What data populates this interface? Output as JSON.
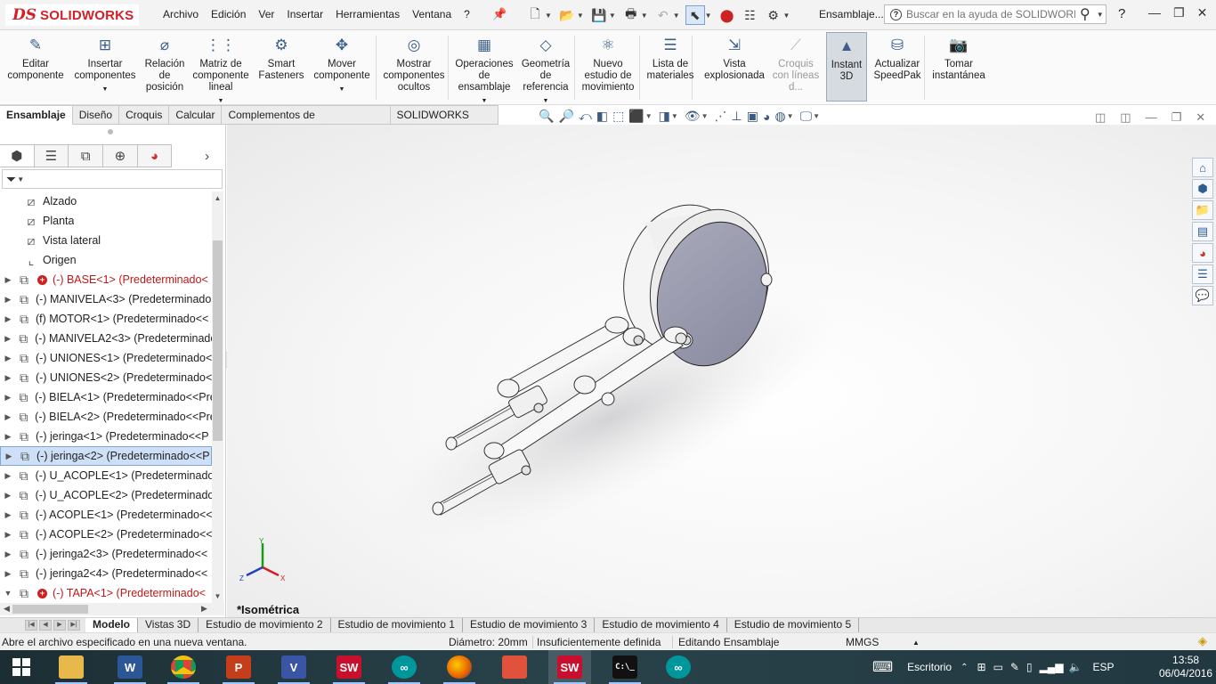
{
  "app": {
    "logo_ds": "DS",
    "logo_text": "SOLIDWORKS",
    "document_title": "Ensamblaje...",
    "search_placeholder": "Buscar en la ayuda de SOLIDWORKS",
    "help_label": "?"
  },
  "menu": [
    "Archivo",
    "Edición",
    "Ver",
    "Insertar",
    "Herramientas",
    "Ventana",
    "?"
  ],
  "ribbon": [
    {
      "label": "Editar componente",
      "icon": "edit-component-icon"
    },
    {
      "label": "Insertar componentes",
      "icon": "insert-components-icon",
      "dropdown": true
    },
    {
      "label": "Relación de posición",
      "icon": "mate-icon"
    },
    {
      "label": "Matriz de componente lineal",
      "icon": "linear-pattern-icon",
      "dropdown": true
    },
    {
      "label": "Smart Fasteners",
      "icon": "smart-fasteners-icon"
    },
    {
      "label": "Mover componente",
      "icon": "move-component-icon",
      "dropdown": true
    },
    {
      "label": "Mostrar componentes ocultos",
      "icon": "show-hidden-icon"
    },
    {
      "label": "Operaciones de ensamblaje",
      "icon": "assembly-features-icon",
      "dropdown": true
    },
    {
      "label": "Geometría de referencia",
      "icon": "reference-geometry-icon",
      "dropdown": true
    },
    {
      "label": "Nuevo estudio de movimiento",
      "icon": "motion-study-icon"
    },
    {
      "label": "Lista de materiales",
      "icon": "bom-icon"
    },
    {
      "label": "Vista explosionada",
      "icon": "exploded-view-icon"
    },
    {
      "label": "Croquis con líneas d...",
      "icon": "explode-line-sketch-icon",
      "disabled": true
    },
    {
      "label": "Instant 3D",
      "icon": "instant3d-icon",
      "active": true
    },
    {
      "label": "Actualizar SpeedPak",
      "icon": "speedpak-icon"
    },
    {
      "label": "Tomar instantánea",
      "icon": "snapshot-icon"
    }
  ],
  "command_tabs": [
    "Ensamblaje",
    "Diseño",
    "Croquis",
    "Calcular",
    "Complementos de SOLIDWORKS",
    "SOLIDWORKS MBD"
  ],
  "active_command_tab": "Ensamblaje",
  "tree": [
    {
      "label": "Alzado",
      "icon": "plane-icon",
      "top": true
    },
    {
      "label": "Planta",
      "icon": "plane-icon",
      "top": true
    },
    {
      "label": "Vista lateral",
      "icon": "plane-icon",
      "top": true
    },
    {
      "label": "Origen",
      "icon": "origin-icon",
      "top": true
    },
    {
      "label": "(-) BASE<1> (Predeterminado<",
      "icon": "part-icon",
      "warning": true,
      "red": true
    },
    {
      "label": "(-) MANIVELA<3> (Predeterminado",
      "icon": "part-icon"
    },
    {
      "label": "(f) MOTOR<1> (Predeterminado<<",
      "icon": "part-icon"
    },
    {
      "label": "(-) MANIVELA2<3> (Predeterminado",
      "icon": "part-icon"
    },
    {
      "label": "(-) UNIONES<1> (Predeterminado<",
      "icon": "part-icon"
    },
    {
      "label": "(-) UNIONES<2> (Predeterminado<",
      "icon": "part-icon"
    },
    {
      "label": "(-) BIELA<1> (Predeterminado<<Pre",
      "icon": "part-icon"
    },
    {
      "label": "(-) BIELA<2> (Predeterminado<<Pre",
      "icon": "part-icon"
    },
    {
      "label": "(-) jeringa<1> (Predeterminado<<P",
      "icon": "part-icon"
    },
    {
      "label": "(-) jeringa<2> (Predeterminado<<P",
      "icon": "part-icon",
      "selected": true
    },
    {
      "label": "(-) U_ACOPLE<1> (Predeterminado",
      "icon": "part-icon"
    },
    {
      "label": "(-) U_ACOPLE<2> (Predeterminado",
      "icon": "part-icon"
    },
    {
      "label": "(-) ACOPLE<1> (Predeterminado<<",
      "icon": "part-icon"
    },
    {
      "label": "(-) ACOPLE<2> (Predeterminado<<",
      "icon": "part-icon"
    },
    {
      "label": "(-) jeringa2<3> (Predeterminado<<",
      "icon": "part-icon"
    },
    {
      "label": "(-) jeringa2<4> (Predeterminado<<",
      "icon": "part-icon"
    },
    {
      "label": "(-) TAPA<1> (Predeterminado<",
      "icon": "part-icon",
      "warning": true,
      "red": true,
      "expanded": true
    }
  ],
  "graphics": {
    "view_name": "*Isométrica",
    "triad": {
      "x": "X",
      "y": "Y",
      "z": "Z"
    }
  },
  "bottom_tabs": [
    "Modelo",
    "Vistas 3D",
    "Estudio de movimiento 2",
    "Estudio de movimiento 1",
    "Estudio de movimiento 3",
    "Estudio de movimiento 4",
    "Estudio de movimiento 5"
  ],
  "active_bottom_tab": "Modelo",
  "status": {
    "message": "Abre el archivo especificado en una nueva ventana.",
    "diameter": "Diámetro: 20mm",
    "definition": "Insuficientemente definida",
    "mode": "Editando Ensamblaje",
    "units": "MMGS",
    "units_arrow": "▲"
  },
  "taskbar": {
    "apps": [
      {
        "name": "file-explorer",
        "label": ""
      },
      {
        "name": "word",
        "label": "W"
      },
      {
        "name": "chrome",
        "label": ""
      },
      {
        "name": "powerpoint",
        "label": "P"
      },
      {
        "name": "visio",
        "label": "V"
      },
      {
        "name": "solidworks-2016-a",
        "label": "SW"
      },
      {
        "name": "arduino-a",
        "label": "∞"
      },
      {
        "name": "firefox",
        "label": ""
      },
      {
        "name": "fritzing",
        "label": ""
      },
      {
        "name": "solidworks-2016-b",
        "label": "SW"
      },
      {
        "name": "cmd",
        "label": "C:\\_"
      },
      {
        "name": "arduino-b",
        "label": "∞"
      }
    ],
    "desktop_label": "Escritorio",
    "language": "ESP",
    "time": "13:58",
    "date": "06/04/2016"
  },
  "colors": {
    "accent": "#d32027",
    "selection": "#cde0f7",
    "model_face": "#9a9aae",
    "model_light": "#f2f2f2",
    "taskbar": "#223840"
  }
}
